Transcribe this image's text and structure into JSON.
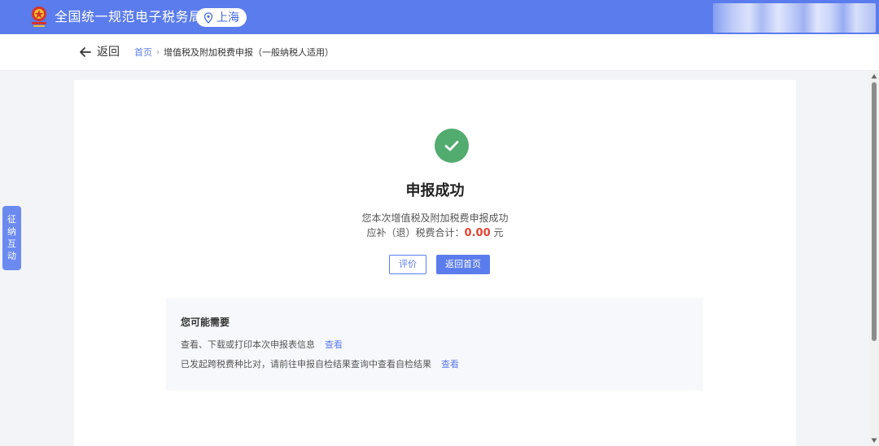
{
  "header": {
    "site_title": "全国统一规范电子税务局",
    "region": "上海",
    "icons": {
      "emblem": "tax-emblem-icon",
      "location": "location-pin-icon"
    }
  },
  "subnav": {
    "back_label": "返回",
    "breadcrumb": {
      "home": "首页",
      "separator": "›",
      "current": "增值税及附加税费申报（一般纳税人适用）"
    }
  },
  "result": {
    "title": "申报成功",
    "description": "您本次增值税及附加税费申报成功",
    "total_label": "应补（退）税费合计：",
    "total_amount": "0.00",
    "total_unit": "元",
    "rate_button": "评价",
    "home_button": "返回首页"
  },
  "needs": {
    "heading": "您可能需要",
    "items": [
      {
        "text": "查看、下载或打印本次申报表信息",
        "link": "查看"
      },
      {
        "text": "已发起跨税费种比对，请前往申报自检结果查询中查看自检结果",
        "link": "查看"
      }
    ]
  },
  "side_tab": {
    "label_chars": [
      "征",
      "纳",
      "互",
      "动"
    ]
  },
  "colors": {
    "primary": "#5b7cec",
    "success": "#52ab6f",
    "amount": "#e04434"
  }
}
